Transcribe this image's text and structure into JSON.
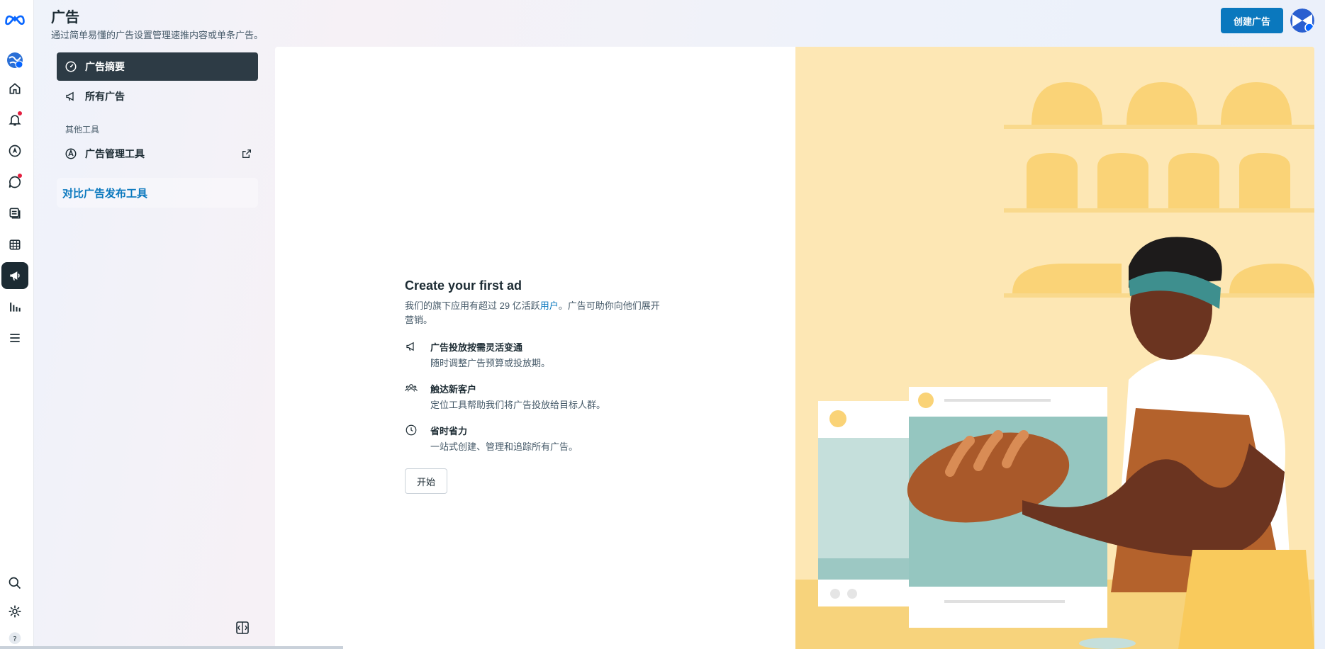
{
  "header": {
    "title": "广告",
    "subtitle": "通过简单易懂的广告设置管理速推内容或单条广告。",
    "create_label": "创建广告"
  },
  "rail": {
    "icons": [
      "meta-logo-icon",
      "profile-globe-icon",
      "home-icon",
      "bell-icon",
      "compass-icon",
      "chat-icon",
      "pages-icon",
      "calendar-icon",
      "megaphone-icon",
      "insights-icon",
      "menu-icon",
      "search-icon",
      "gear-icon",
      "help-icon"
    ]
  },
  "sidenav": {
    "items": [
      {
        "label": "广告摘要",
        "icon": "dashboard-icon",
        "active": true
      },
      {
        "label": "所有广告",
        "icon": "megaphone-icon",
        "active": false
      }
    ],
    "other_tools_label": "其他工具",
    "ads_manager_label": "广告管理工具",
    "compare_link": "对比广告发布工具"
  },
  "main": {
    "title": "Create your first ad",
    "desc_before": "我们的旗下应用有超过 29 亿活跃",
    "desc_link": "用户",
    "desc_after": "。广告可助你向他们展开营销。",
    "features": [
      {
        "icon": "megaphone-icon",
        "title": "广告投放按需灵活变通",
        "desc": "随时调整广告预算或投放期。"
      },
      {
        "icon": "people-icon",
        "title": "触达新客户",
        "desc": "定位工具帮助我们将广告投放给目标人群。"
      },
      {
        "icon": "clock-icon",
        "title": "省时省力",
        "desc": "一站式创建、管理和追踪所有广告。"
      }
    ],
    "start_label": "开始"
  },
  "colors": {
    "accent": "#0a78be",
    "active_nav": "#2d3b45",
    "illustration_bg": "#fde7b4"
  }
}
